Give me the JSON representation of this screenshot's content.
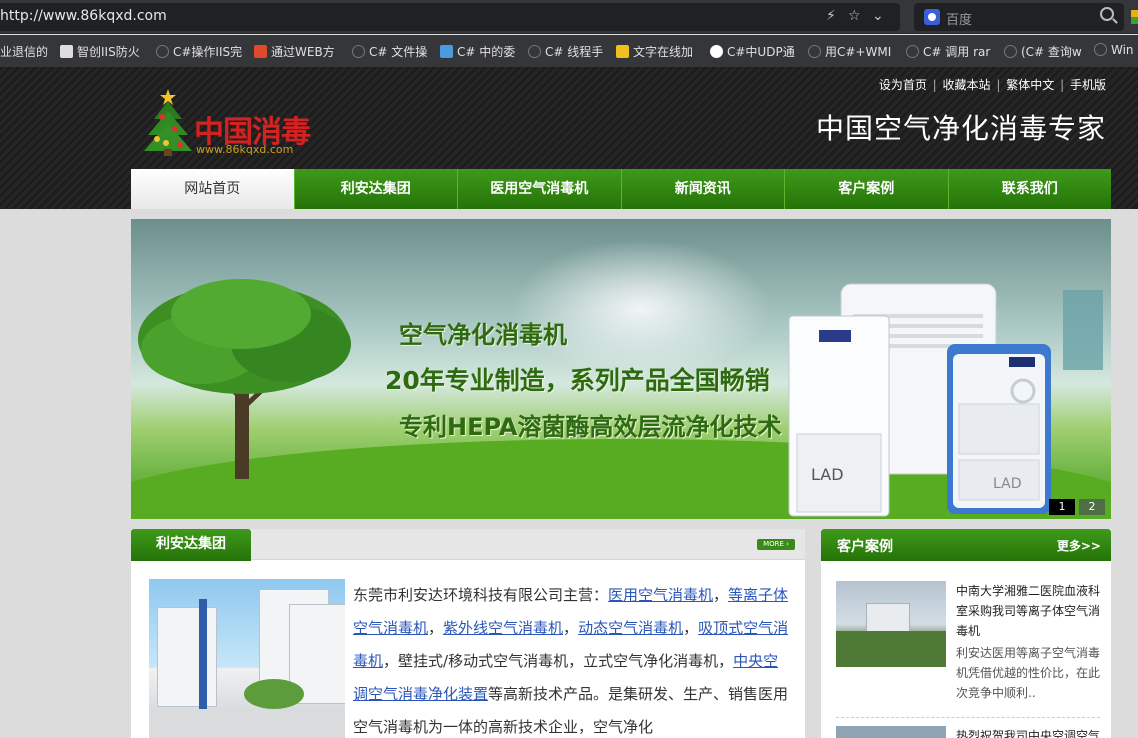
{
  "browser": {
    "url": "http://www.86kqxd.com",
    "search_placeholder": "百度",
    "bookmarks": [
      "业退信的",
      "智创IIS防火",
      "C#操作IIS完",
      "通过WEB方",
      "C# 文件操",
      "C# 中的委",
      "C# 线程手",
      "文字在线加",
      "C#中UDP通",
      "用C#+WMI",
      "C# 调用 rar",
      "(C# 查询w",
      "Win"
    ]
  },
  "header": {
    "logo_text": "中国消毒",
    "logo_url": "www.86kqxd.com",
    "top_links": [
      "设为首页",
      "收藏本站",
      "繁体中文",
      "手机版"
    ],
    "slogan": "中国空气净化消毒专家"
  },
  "nav": {
    "items": [
      "网站首页",
      "利安达集团",
      "医用空气消毒机",
      "新闻资讯",
      "客户案例",
      "联系我们"
    ]
  },
  "banner": {
    "line1": "空气净化消毒机",
    "line2": "20年专业制造，系列产品全国畅销",
    "line3": "专利HEPA溶菌酶高效层流净化技术",
    "product_label": "LAD",
    "pager": [
      "1",
      "2"
    ]
  },
  "about": {
    "title": "利安达集团",
    "more": "MORE",
    "intro_prefix": "东莞市利安达环境科技有限公司主营：",
    "links": [
      "医用空气消毒机",
      "等离子体空气消毒机",
      "紫外线空气消毒机",
      "动态空气消毒机",
      "吸顶式空气消毒机",
      "中央空调空气消毒净化装置"
    ],
    "sep": "，",
    "mid_text": "，壁挂式/移动式空气消毒机，立式空气净化消毒机，",
    "tail_text": "等高新技术产品。是集研发、生产、销售医用空气消毒机为一体的高新技术企业，空气净化"
  },
  "cases": {
    "title": "客户案例",
    "more": "更多>>",
    "item_title": "中南大学湘雅二医院血液科室采购我司等离子体空气消毒机",
    "item_desc": "利安达医用等离子空气消毒机凭借优越的性价比，在此次竞争中顺利..",
    "item2_title": "热烈祝贺我司中央空调空气"
  },
  "colors": {
    "nav_green": "#2f8a10",
    "header_bg": "#1f1f1f",
    "logo_red": "#d32222",
    "link_blue": "#2a56b8"
  }
}
